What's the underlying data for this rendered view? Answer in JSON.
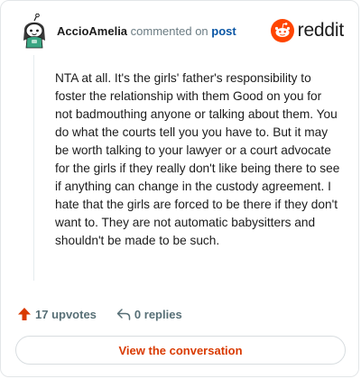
{
  "header": {
    "username": "AccioAmelia",
    "action_text": "commented on",
    "post_link": "post",
    "brand_name": "reddit",
    "avatar_icon": "snoo-avatar-icon",
    "brand_icon": "reddit-snoo-logo-icon"
  },
  "comment": {
    "body": "NTA at all. It's the girls' father's responsibility to foster the relationship with them Good on you for not badmouthing anyone or talking about them. You do what the courts tell you you have to. But it may be worth talking to your lawyer or a court advocate for the girls if they really don't like being there to see if anything can change in the custody agreement. I hate that the girls are forced to be there if they don't want to. They are not automatic babysitters and shouldn't be made to be such."
  },
  "footer": {
    "upvotes": "17 upvotes",
    "replies": "0 replies",
    "upvote_icon": "upvote-arrow-icon",
    "reply_icon": "reply-arrow-icon"
  },
  "cta": {
    "label": "View the conversation"
  },
  "colors": {
    "accent": "#d93a00",
    "reddit_orange": "#ff4500",
    "link": "#0a56a5",
    "muted": "#576f76"
  }
}
